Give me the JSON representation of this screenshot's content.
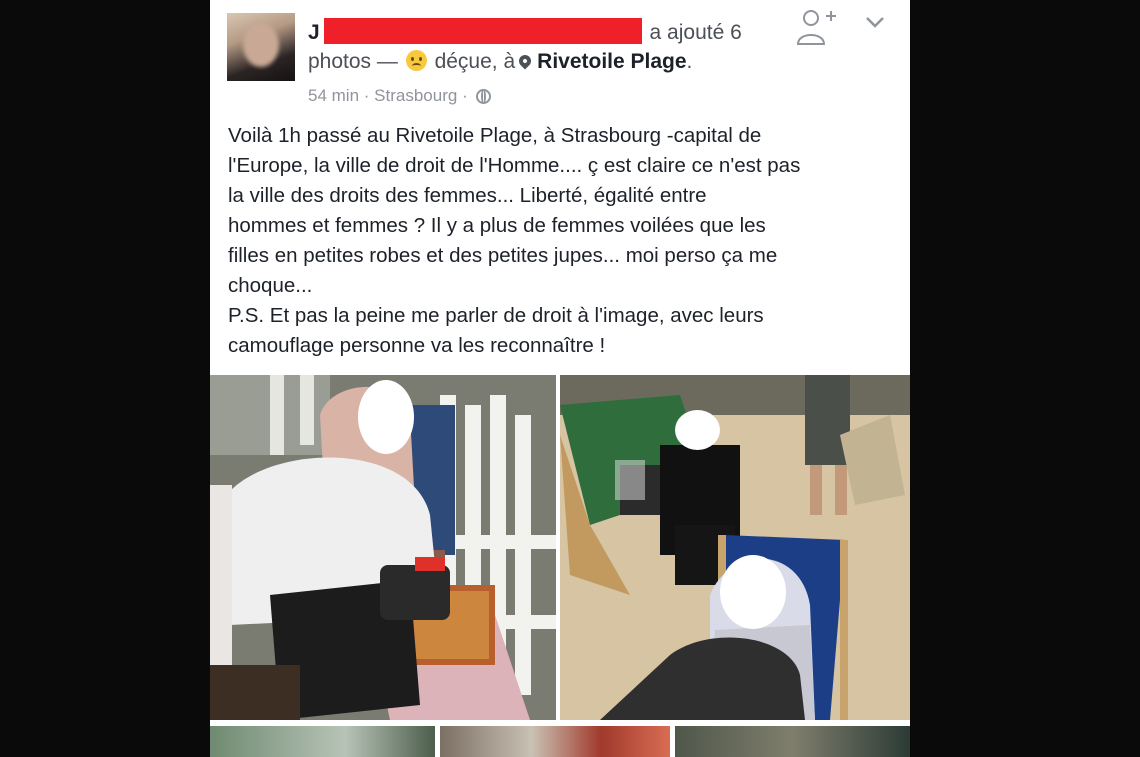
{
  "post": {
    "author_initial": "J",
    "action": "a ajouté 6",
    "action_cont": "photos —",
    "feeling": "déçue, à",
    "place": "Rivetoile Plage",
    "place_suffix": ".",
    "time": "54 min",
    "separator": "·",
    "location": "Strasbourg",
    "separator2": "·",
    "text_lines": [
      "Voilà 1h passé au Rivetoile Plage, à Strasbourg -capital de",
      "l'Europe, la ville de droit de l'Homme.... ç est claire ce n'est pas",
      "la ville des droits des femmes... Liberté, égalité entre",
      "hommes et femmes ? Il y a plus de femmes voilées que les",
      "filles en petites robes et des petites jupes... moi perso ça me",
      "choque...",
      "P.S. Et pas la peine me parler de droit à l'image, avec leurs",
      "camouflage personne va les reconnaître !"
    ]
  },
  "icons": {
    "avatar": "profile-photo",
    "feeling_emoji": "disappointed-face-icon",
    "location": "map-pin-icon",
    "privacy": "globe-icon",
    "add_friend": "add-friend-icon",
    "menu": "chevron-down-icon"
  },
  "colors": {
    "redaction": "#f0202a",
    "text_primary": "#1d2129",
    "text_secondary": "#4b4f56",
    "text_meta": "#90949c"
  }
}
